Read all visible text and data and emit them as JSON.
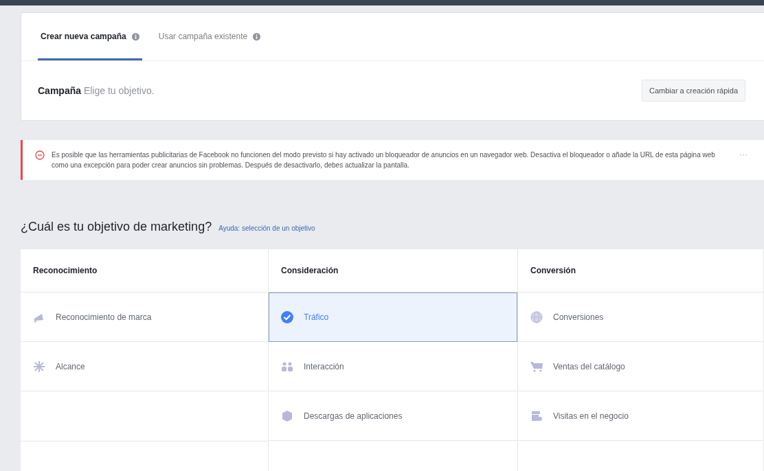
{
  "tabs": [
    {
      "label": "Crear nueva campaña",
      "selected": true
    },
    {
      "label": "Usar campaña existente",
      "selected": false
    }
  ],
  "campaign": {
    "title": "Campaña",
    "hint": "Elige tu objetivo.",
    "button": "Cambiar a creación rápida"
  },
  "alert": {
    "text": "Es posible que las herramientas publicitarias de Facebook no funcionen del modo previsto si hay activado un bloqueador de anuncios en un navegador web. Desactiva el bloqueador o añade la URL de esta página web como una excepción para poder crear anuncios sin problemas. Después de desactivarlo, debes actualizar la pantalla.",
    "menu": "···"
  },
  "objective": {
    "question": "¿Cuál es tu objetivo de marketing?",
    "help_link": "Ayuda: selección de un objetivo"
  },
  "columns": [
    {
      "title": "Reconocimiento",
      "items": [
        {
          "label": "Reconocimiento de marca",
          "kind": "megaphone",
          "selected": false
        },
        {
          "label": "Alcance",
          "kind": "reach",
          "selected": false
        }
      ]
    },
    {
      "title": "Consideración",
      "items": [
        {
          "label": "Tráfico",
          "selected": true
        },
        {
          "label": "Interacción",
          "kind": "people",
          "selected": false
        },
        {
          "label": "Descargas de aplicaciones",
          "kind": "cube",
          "selected": false
        }
      ]
    },
    {
      "title": "Conversión",
      "items": [
        {
          "label": "Conversiones",
          "kind": "globe",
          "selected": false
        },
        {
          "label": "Ventas del catálogo",
          "kind": "cart",
          "selected": false
        },
        {
          "label": "Visitas en el negocio",
          "kind": "store",
          "selected": false
        }
      ]
    }
  ]
}
